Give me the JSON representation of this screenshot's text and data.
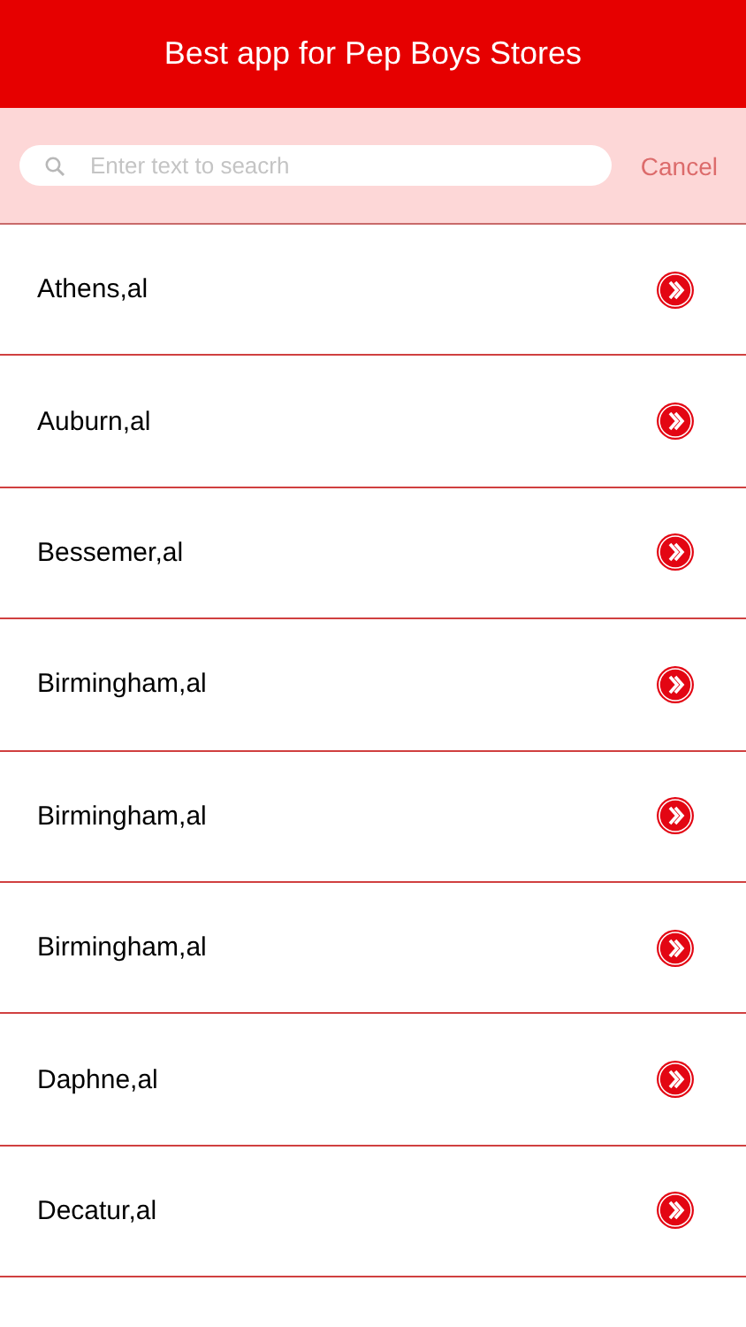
{
  "header": {
    "title": "Best app for Pep Boys Stores"
  },
  "search": {
    "placeholder": "Enter text to seacrh",
    "cancel": "Cancel"
  },
  "stores": [
    {
      "name": "Athens,al"
    },
    {
      "name": "Auburn,al"
    },
    {
      "name": "Bessemer,al"
    },
    {
      "name": "Birmingham,al"
    },
    {
      "name": "Birmingham,al"
    },
    {
      "name": "Birmingham,al"
    },
    {
      "name": "Daphne,al"
    },
    {
      "name": "Decatur,al"
    }
  ]
}
